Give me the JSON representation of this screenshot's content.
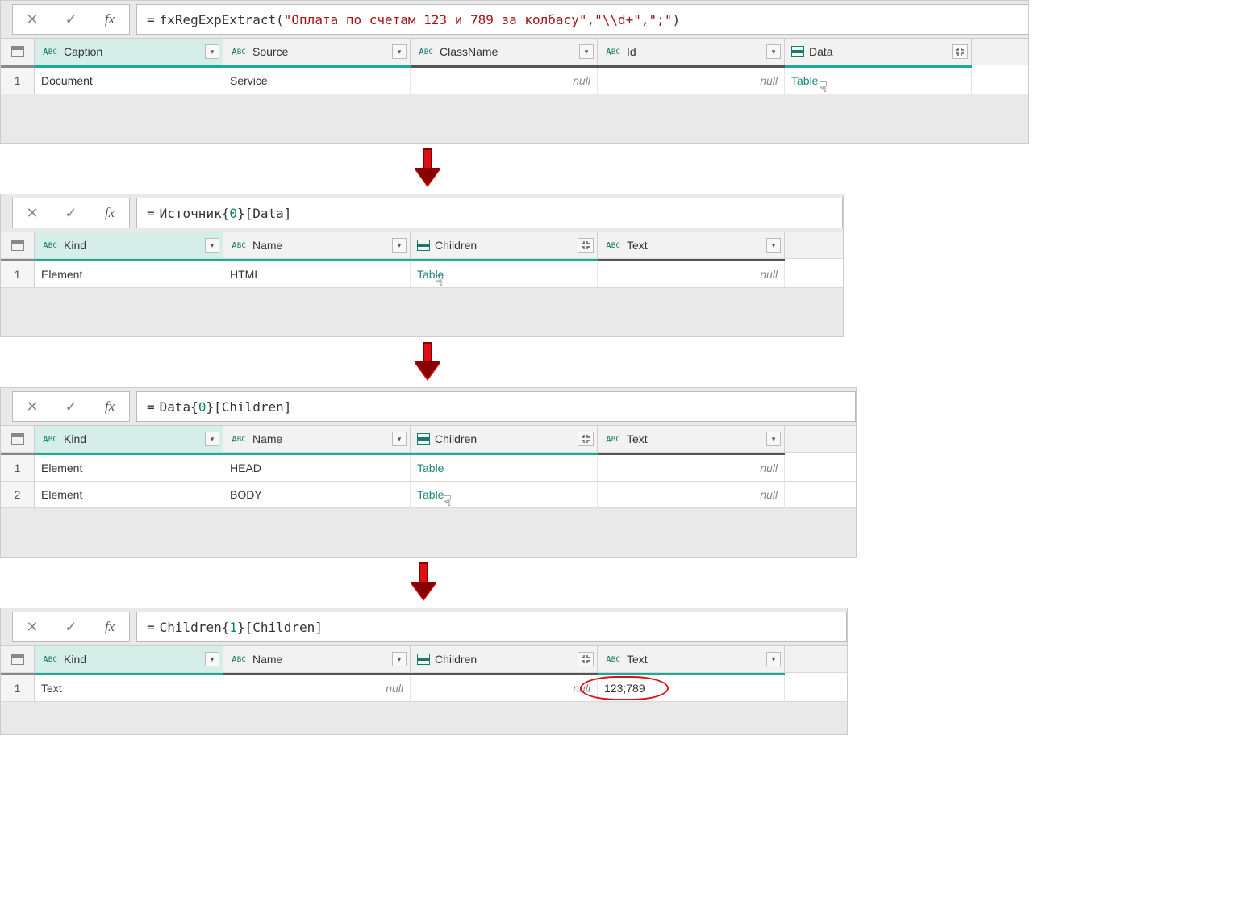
{
  "panels": [
    {
      "formula": {
        "prefix": "=",
        "fn": "fxRegExpExtract",
        "args": [
          "\"Оплата по счетам 123 и 789 за колбасу\"",
          "\"\\\\d+\"",
          "\";\""
        ]
      },
      "columns": [
        "Caption",
        "Source",
        "ClassName",
        "Id",
        "Data"
      ],
      "selected_col": 0,
      "rows": [
        {
          "num": "1",
          "cells": [
            "Document",
            "Service",
            null,
            null,
            {
              "link": "Table"
            }
          ]
        }
      ],
      "cursor_after_col": 4
    },
    {
      "formula_plain": "= Источник{0}[Data]",
      "columns": [
        "Kind",
        "Name",
        "Children",
        "Text"
      ],
      "selected_col": 0,
      "rows": [
        {
          "num": "1",
          "cells": [
            "Element",
            "HTML",
            {
              "link": "Table"
            },
            null
          ]
        }
      ],
      "cursor_after_col": 2
    },
    {
      "formula_plain": "= Data{0}[Children]",
      "columns": [
        "Kind",
        "Name",
        "Children",
        "Text"
      ],
      "selected_col": 0,
      "rows": [
        {
          "num": "1",
          "cells": [
            "Element",
            "HEAD",
            {
              "link": "Table"
            },
            null
          ]
        },
        {
          "num": "2",
          "cells": [
            "Element",
            "BODY",
            {
              "link": "Table"
            },
            null
          ]
        }
      ],
      "cursor_after_col": 2,
      "cursor_row": 2
    },
    {
      "formula_plain": "= Children{1}[Children]",
      "columns": [
        "Kind",
        "Name",
        "Children",
        "Text"
      ],
      "selected_col": 0,
      "rows": [
        {
          "num": "1",
          "cells": [
            "Text",
            null,
            null,
            "123;789"
          ]
        }
      ],
      "circle_col": 3
    }
  ],
  "col_types": {
    "Caption": "text",
    "Source": "text",
    "ClassName": "text",
    "Id": "text",
    "Data": "table",
    "Kind": "text",
    "Name": "text",
    "Children": "table",
    "Text": "text"
  },
  "widths": {
    "Caption": "w-cap",
    "Source": "w-src",
    "ClassName": "w-cls",
    "Id": "w-id",
    "Data": "w-data",
    "Kind": "w-kind",
    "Name": "w-name",
    "Children": "w-child",
    "Text": "w-text"
  }
}
